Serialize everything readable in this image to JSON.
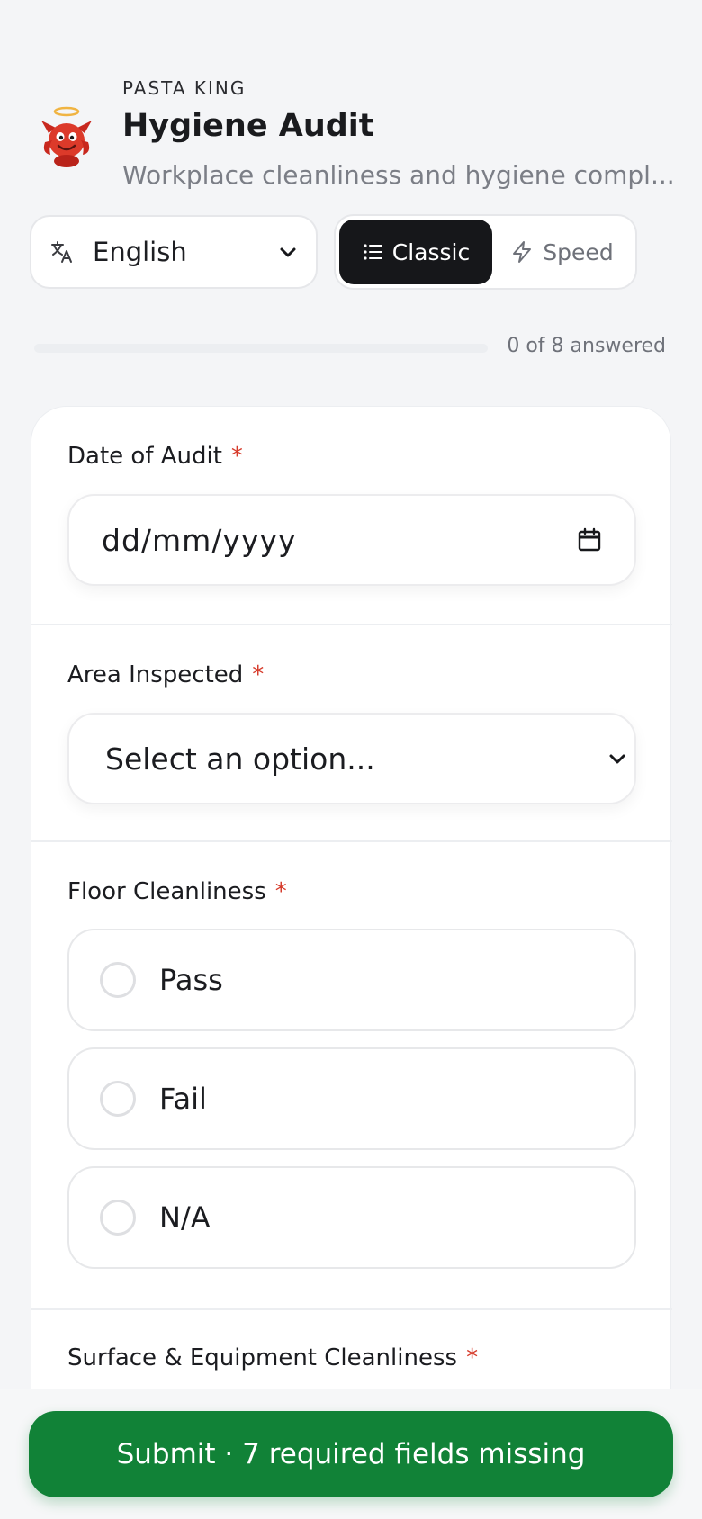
{
  "header": {
    "brand": "PASTA KING",
    "title": "Hygiene Audit",
    "subtitle": "Workplace cleanliness and hygiene compl..."
  },
  "controls": {
    "language": "English",
    "modes": {
      "classic": "Classic",
      "speed": "Speed"
    },
    "active_mode": "classic"
  },
  "progress": {
    "text": "0 of 8 answered",
    "fraction": 0
  },
  "questions": {
    "date": {
      "label": "Date of Audit",
      "required": "*",
      "placeholder": "dd/mm/yyyy"
    },
    "area": {
      "label": "Area Inspected",
      "required": "*",
      "placeholder": "Select an option..."
    },
    "floor": {
      "label": "Floor Cleanliness",
      "required": "*",
      "options": [
        "Pass",
        "Fail",
        "N/A"
      ]
    },
    "surface": {
      "label": "Surface & Equipment Cleanliness",
      "required": "*"
    }
  },
  "submit": {
    "label": "Submit · 7 required fields missing"
  },
  "colors": {
    "accent_dark": "#16171a",
    "submit_green": "#118237",
    "required_red": "#d63a2a"
  }
}
